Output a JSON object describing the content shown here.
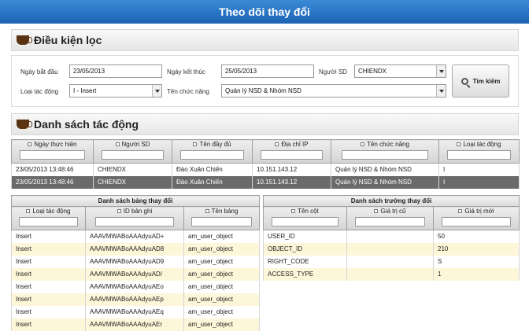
{
  "app": {
    "title": "Theo dõi thay đổi"
  },
  "filter": {
    "heading": "Điều kiện lọc",
    "start_date_label": "Ngày bắt đầu",
    "start_date_value": "23/05/2013",
    "end_date_label": "Ngày kết thúc",
    "end_date_value": "25/05/2013",
    "user_label": "Người SD",
    "user_value": "CHIENDX",
    "action_type_label": "Loại tác động",
    "action_type_value": "I - Insert",
    "function_label": "Tên chức năng",
    "function_value": "Quản lý NSD & Nhóm NSD",
    "search_label": "Tìm kiếm"
  },
  "actions": {
    "heading": "Danh sách tác động",
    "columns": [
      "Ngày thực hiện",
      "Người SD",
      "Tên đầy đủ",
      "Địa chỉ IP",
      "Tên chức năng",
      "Loại tác động"
    ],
    "rows": [
      [
        "23/05/2013 13:48:46",
        "CHIENDX",
        "Đào Xuân Chiến",
        "10.151.143.12",
        "Quản lý NSD & Nhóm NSD",
        "I"
      ],
      [
        "23/05/2013 13:48:46",
        "CHIENDX",
        "Đào Xuân Chiến",
        "10.151.143.12",
        "Quản lý NSD & Nhóm NSD",
        "I"
      ]
    ]
  },
  "tables_changed": {
    "caption": "Danh sách bảng thay đổi",
    "columns": [
      "Loại tác động",
      "ID bản ghi",
      "Tên bảng"
    ],
    "rows": [
      [
        "Insert",
        "AAAVMWABoAAAdyuAD+",
        "am_user_object"
      ],
      [
        "Insert",
        "AAAVMWABoAAAdyuAD8",
        "am_user_object"
      ],
      [
        "Insert",
        "AAAVMWABoAAAdyuAD9",
        "am_user_object"
      ],
      [
        "Insert",
        "AAAVMWABoAAAdyuAD/",
        "am_user_object"
      ],
      [
        "Insert",
        "AAAVMWABoAAAdyuAEo",
        "am_user_object"
      ],
      [
        "Insert",
        "AAAVMWABoAAAdyuAEp",
        "am_user_object"
      ],
      [
        "Insert",
        "AAAVMWABoAAAdyuAEq",
        "am_user_object"
      ],
      [
        "Insert",
        "AAAVMWABoAAAdyuAEr",
        "am_user_object"
      ]
    ]
  },
  "fields_changed": {
    "caption": "Danh sách trường thay đổi",
    "columns": [
      "Tên cột",
      "Giá trị cũ",
      "Giá trị mới"
    ],
    "rows": [
      [
        "USER_ID",
        "",
        "50"
      ],
      [
        "OBJECT_ID",
        "",
        "210"
      ],
      [
        "RIGHT_CODE",
        "",
        "S"
      ],
      [
        "ACCESS_TYPE",
        "",
        "1"
      ]
    ]
  }
}
